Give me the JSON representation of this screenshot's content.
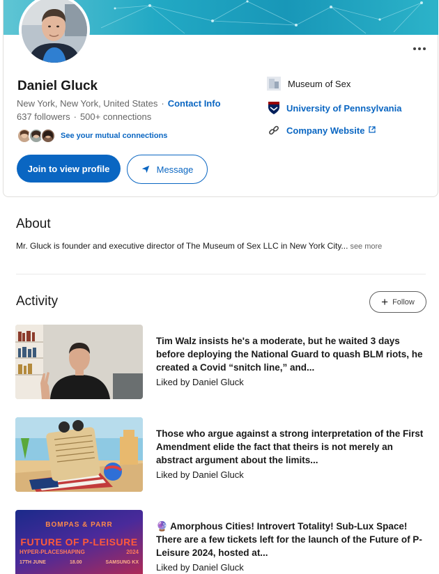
{
  "profile": {
    "name": "Daniel Gluck",
    "location": "New York, New York, United States",
    "contact_info": "Contact Info",
    "followers": "637 followers",
    "connections": "500+ connections",
    "mutual_connections": "See your mutual connections",
    "join_button": "Join to view profile",
    "message_button": "Message",
    "current_company": "Museum of Sex",
    "education": "University of Pennsylvania",
    "company_website": "Company Website"
  },
  "about": {
    "title": "About",
    "text": "Mr. Gluck is founder and executive director of The Museum of Sex LLC in New York City...",
    "see_more": "see more"
  },
  "activity": {
    "title": "Activity",
    "follow_button": "Follow",
    "posts": [
      {
        "text": "Tim Walz insists he's a moderate, but he waited 3 days before deploying the National Guard to quash BLM riots, he created a Covid “snitch line,” and...",
        "liked_by": "Liked by Daniel Gluck"
      },
      {
        "text": "Those who argue against a strong interpretation of the First Amendment elide the fact that theirs is not merely an abstract argument about the limits...",
        "liked_by": "Liked by Daniel Gluck"
      },
      {
        "emoji": "🔮",
        "text": "Amorphous Cities! Introvert Totality! Sub-Lux Space! There are a few tickets left for the launch of the Future of P-Leisure 2024, hosted at...",
        "liked_by": "Liked by Daniel Gluck",
        "thumb_text": {
          "brand": "BOMPAS & PARR",
          "headline": "FUTURE OF P-LEISURE",
          "subhead": "HYPER-PLACESHAPING",
          "year": "2024",
          "date": "17TH JUNE",
          "time": "18.00",
          "venue": "SAMSUNG KX"
        }
      }
    ]
  },
  "colors": {
    "accent": "#0a66c2",
    "text": "#191919",
    "muted": "#666666"
  }
}
